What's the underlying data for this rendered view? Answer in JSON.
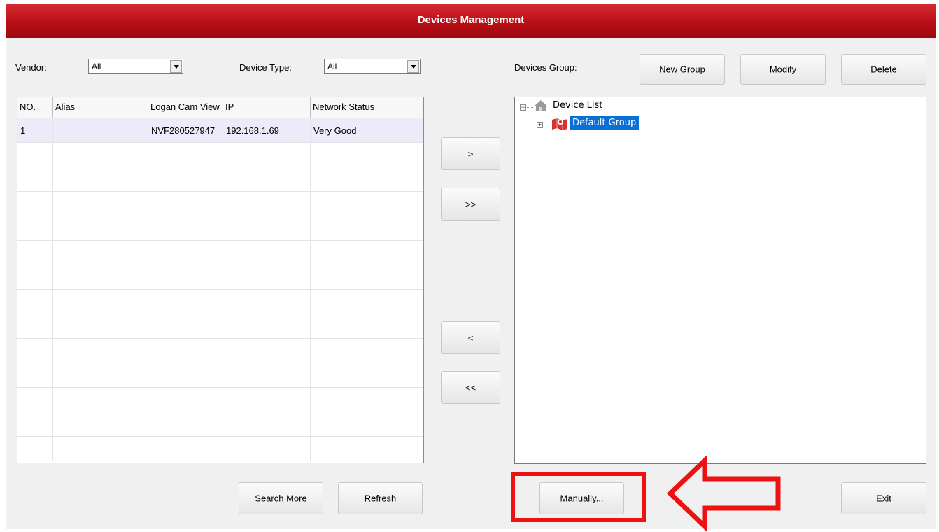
{
  "window": {
    "title": "Devices Management"
  },
  "filters": {
    "vendor_label": "Vendor:",
    "vendor_value": "All",
    "device_type_label": "Device Type:",
    "device_type_value": "All"
  },
  "table": {
    "columns": [
      "NO.",
      "Alias",
      "Logan Cam View",
      "IP",
      "Network Status"
    ],
    "rows": [
      {
        "no": "1",
        "alias": "",
        "name": "NVF280527947",
        "ip": "192.168.1.69",
        "status": "Very Good"
      }
    ]
  },
  "transfer": {
    "add": ">",
    "add_all": ">>",
    "remove": "<",
    "remove_all": "<<"
  },
  "groups": {
    "label": "Devices Group:",
    "new_group": "New Group",
    "modify": "Modify",
    "delete": "Delete",
    "tree_root": "Device List",
    "tree_child": "Default Group"
  },
  "actions": {
    "search_more": "Search More",
    "refresh": "Refresh",
    "manually": "Manually...",
    "exit": "Exit"
  },
  "colors": {
    "title_bar": "#b80f16",
    "selected_tree_item": "#0a6fd6",
    "annotation": "#ee1111"
  }
}
